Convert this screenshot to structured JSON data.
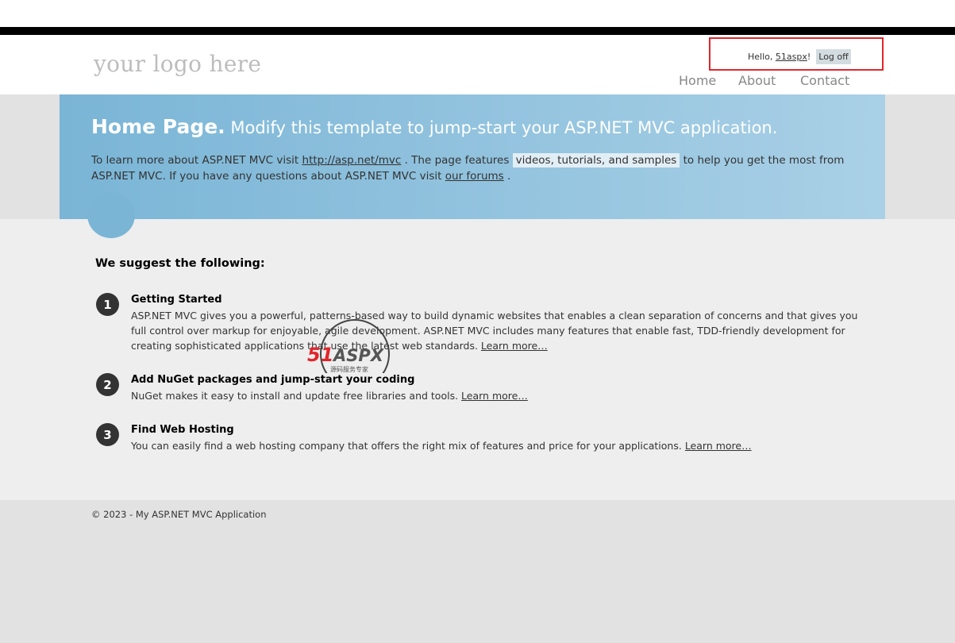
{
  "header": {
    "logo": "your logo here",
    "login": {
      "hello": "Hello, ",
      "user": "51aspx",
      "excl": "!",
      "logoff": "Log off"
    },
    "nav": [
      "Home",
      "About",
      "Contact"
    ]
  },
  "featured": {
    "title_strong": "Home Page.",
    "title_rest": " Modify this template to jump-start your ASP.NET MVC application.",
    "text_1": "To learn more about ASP.NET MVC visit ",
    "link_mvc": "http://asp.net/mvc",
    "text_2": " . The page features ",
    "highlight": "videos, tutorials, and samples",
    "text_3": " to help you get the most from ASP.NET MVC. If you have any questions about ASP.NET MVC visit ",
    "link_forums": "our forums",
    "text_4": " ."
  },
  "main": {
    "heading": "We suggest the following:",
    "items": [
      {
        "num": "1",
        "title": "Getting Started",
        "text": "ASP.NET MVC gives you a powerful, patterns-based way to build dynamic websites that enables a clean separation of concerns and that gives you full control over markup for enjoyable, agile development. ASP.NET MVC includes many features that enable fast, TDD-friendly development for creating sophisticated applications that use the latest web standards. ",
        "link": "Learn more…"
      },
      {
        "num": "2",
        "title": "Add NuGet packages and jump-start your coding",
        "text": "NuGet makes it easy to install and update free libraries and tools. ",
        "link": "Learn more…"
      },
      {
        "num": "3",
        "title": "Find Web Hosting",
        "text": "You can easily find a web hosting company that offers the right mix of features and price for your applications. ",
        "link": "Learn more…"
      }
    ]
  },
  "footer": {
    "text": "© 2023 - My ASP.NET MVC Application"
  },
  "watermark": {
    "brand_a": "51",
    "brand_b": "ASPX",
    "tagline": "源码服务专家"
  },
  "colors": {
    "featured_start": "#7ab5d6",
    "featured_end": "#a9d0e6",
    "highlight_box": "#e0262b",
    "watermark_red": "#e0262b",
    "watermark_green": "#3aa84a"
  }
}
